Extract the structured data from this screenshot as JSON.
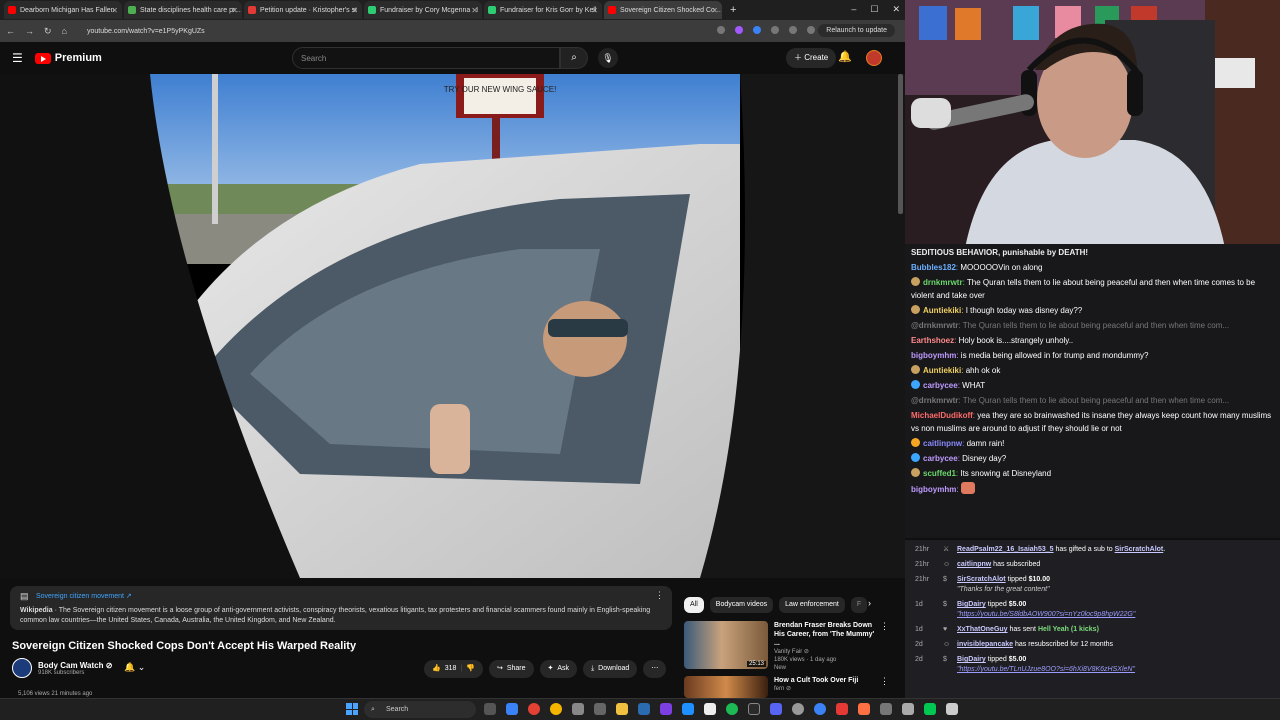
{
  "browser": {
    "tabs": [
      {
        "title": "Dearborn Michigan Has Fallen",
        "fav": "#ff0000"
      },
      {
        "title": "State disciplines health care pr...",
        "fav": "#4caf50"
      },
      {
        "title": "Petition update · Kristopher's st",
        "fav": "#e53935"
      },
      {
        "title": "Fundraiser by Cory Mcgenna : I",
        "fav": "#2ecc71"
      },
      {
        "title": "Fundraiser for Kris Gorr by Kell",
        "fav": "#2ecc71"
      },
      {
        "title": "Sovereign Citizen Shocked Co...",
        "fav": "#ff0000"
      }
    ],
    "url": "youtube.com/watch?v=e1P5yPKgUZs",
    "relaunch": "Relaunch to update"
  },
  "youtube": {
    "brand": "Premium",
    "search_placeholder": "Search",
    "create": "Create",
    "wiki": {
      "title": "Sovereign citizen movement ↗",
      "source": "Wikipedia",
      "text": "The Sovereign citizen movement is a loose group of anti-government activists, conspiracy theorists, vexatious litigants, tax protesters and financial scammers found mainly in English-speaking common law countries—the United States, Canada, Australia, the United Kingdom, and New Zealand."
    },
    "video_title": "Sovereign Citizen Shocked Cops Don't Accept His Warped Reality",
    "channel": {
      "name": "Body Cam Watch ⊘",
      "subs": "918K subscribers"
    },
    "actions": {
      "likes": "318",
      "share": "Share",
      "ask": "Ask",
      "download": "Download"
    },
    "views": "5,106 views  21 minutes ago",
    "chips": [
      "All",
      "Bodycam videos",
      "Law enforcement",
      "F"
    ],
    "recs": [
      {
        "title": "Brendan Fraser Breaks Down His Career, from 'The Mummy' ...",
        "channel": "Vanity Fair ⊘",
        "meta": "180K views · 1 day ago",
        "badge": "New",
        "duration": "25:13"
      },
      {
        "title": "How a Cult Took Over Fiji",
        "channel": "fern ⊘",
        "meta": "",
        "badge": "",
        "duration": ""
      }
    ],
    "video_sign": "TRY OUR NEW WING SAUCE!"
  },
  "chat": {
    "pinned": "SEDITIOUS BEHAVIOR, punishable by DEATH!",
    "messages": [
      {
        "user": "Bubbles182",
        "color": "#6ab0ff",
        "text": "MOOOOOVin on along",
        "badge": ""
      },
      {
        "user": "drnkmrwtr",
        "color": "#6bd96b",
        "text": "The Quran tells them to lie about being peaceful and then when time comes to be violent and take over",
        "badge": "#c8a060"
      },
      {
        "user": "Auntiekiki",
        "color": "#f0d060",
        "text": "I though today was disney day??",
        "badge": "#c8a060"
      },
      {
        "user": "@drnkmrwtr",
        "color": "#777",
        "text": "The Quran tells them to lie about being peaceful and then when time com...",
        "badge": "",
        "faded": true
      },
      {
        "user": "Earthshoez",
        "color": "#ff8a8a",
        "text": "Holy book is....strangely unholy..",
        "badge": ""
      },
      {
        "user": "bigboymhm",
        "color": "#bf9bff",
        "text": "is media being allowed in for trump and mondummy?",
        "badge": ""
      },
      {
        "user": "Auntiekiki",
        "color": "#f0d060",
        "text": "ahh ok ok",
        "badge": "#c8a060"
      },
      {
        "user": "carbycee",
        "color": "#bf9bff",
        "text": "WHAT",
        "badge": "#3ba5ff"
      },
      {
        "user": "@drnkmrwtr",
        "color": "#777",
        "text": "The Quran tells them to lie about being peaceful and then when time com...",
        "badge": "",
        "faded": true
      },
      {
        "user": "MichaelDudikoff",
        "color": "#ff6b6b",
        "text": "yea they are so brainwashed its insane they always keep count how many muslims vs non muslims are around to adjust if they should lie or not",
        "badge": ""
      },
      {
        "user": "caitlinpnw",
        "color": "#8a8aff",
        "text": "damn rain!",
        "badge": "#f5a623"
      },
      {
        "user": "carbycee",
        "color": "#bf9bff",
        "text": "Disney day?",
        "badge": "#3ba5ff"
      },
      {
        "user": "scuffed1",
        "color": "#6bd96b",
        "text": "Its snowing at Disneyland",
        "badge": "#c8a060"
      },
      {
        "user": "bigboymhm",
        "color": "#bf9bff",
        "text": "",
        "badge": ""
      }
    ]
  },
  "events": [
    {
      "time": "21hr",
      "name": "ReadPsalm22_16_Isaiah53_5",
      "text": " has gifted a sub to ",
      "name2": "SirScratchAlot",
      "end": ".",
      "sub": "",
      "link": ""
    },
    {
      "time": "21hr",
      "name": "caitlinpnw",
      "text": " has subscribed",
      "name2": "",
      "end": "",
      "sub": "",
      "link": ""
    },
    {
      "time": "21hr",
      "name": "SirScratchAlot",
      "text": " tipped ",
      "name2": "",
      "end": "$10.00",
      "sub": "\"Thanks for the great content\"",
      "link": ""
    },
    {
      "time": "1d",
      "name": "BigDairy",
      "text": " tipped ",
      "name2": "",
      "end": "$5.00",
      "sub": "",
      "link": "\"https://youtu.be/S8ldbAOW900?si=nYz0loc9p8hpW22G\""
    },
    {
      "time": "1d",
      "name": "XxThatOneGuy",
      "text": " has sent ",
      "name2": "",
      "end": "Hell Yeah (1 kicks)",
      "sub": "",
      "link": ""
    },
    {
      "time": "2d",
      "name": "invisiblepancake",
      "text": " has resubscribed for 12 months",
      "name2": "",
      "end": "",
      "sub": "",
      "link": ""
    },
    {
      "time": "2d",
      "name": "BigDairy",
      "text": " tipped ",
      "name2": "",
      "end": "$5.00",
      "sub": "",
      "link": "\"https://youtu.be/TLnUJzue8OO?si=6hXi8V8K6zHSXleN\""
    }
  ],
  "taskbar": {
    "search": "Search"
  }
}
